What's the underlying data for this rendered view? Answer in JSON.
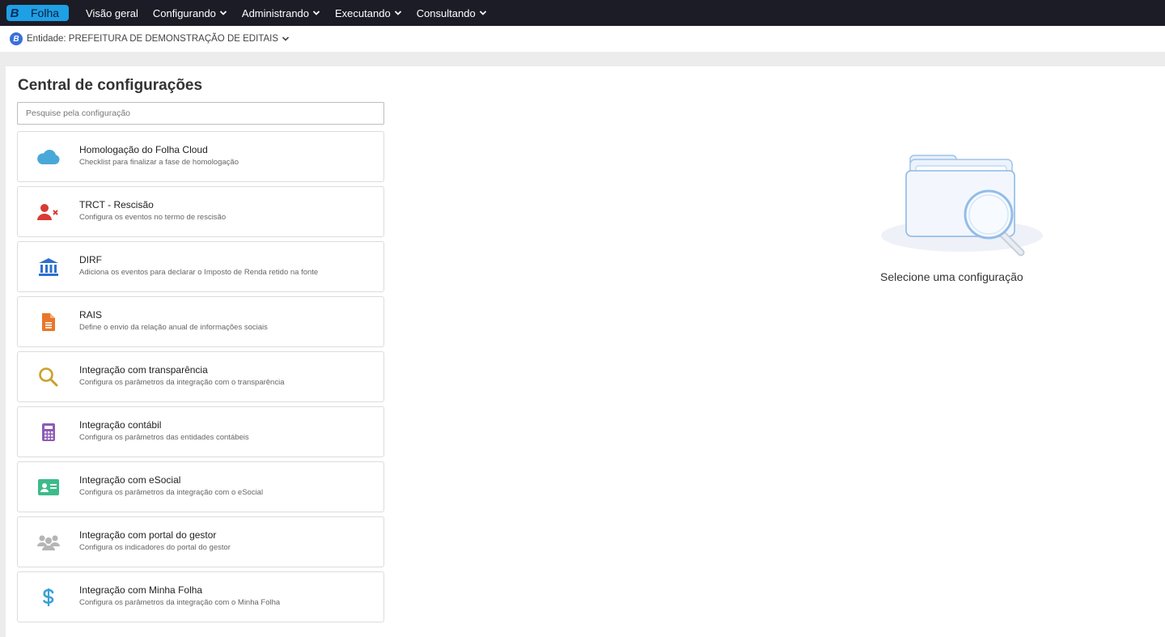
{
  "topbar": {
    "brand_letter": "B",
    "brand_name": "Folha",
    "nav": [
      {
        "label": "Visão geral",
        "dropdown": false
      },
      {
        "label": "Configurando",
        "dropdown": true
      },
      {
        "label": "Administrando",
        "dropdown": true
      },
      {
        "label": "Executando",
        "dropdown": true
      },
      {
        "label": "Consultando",
        "dropdown": true
      }
    ]
  },
  "entity": {
    "logo_letter": "B",
    "label": "Entidade: PREFEITURA DE DEMONSTRAÇÃO DE EDITAIS"
  },
  "main": {
    "title": "Central de configurações",
    "search_placeholder": "Pesquise pela configuração",
    "items": [
      {
        "title": "Homologação do Folha Cloud",
        "desc": "Checklist para finalizar a fase de homologação",
        "icon": "cloud-icon",
        "color": "#4aa8d8"
      },
      {
        "title": "TRCT - Rescisão",
        "desc": "Configura os eventos no termo de rescisão",
        "icon": "user-remove-icon",
        "color": "#d93a33"
      },
      {
        "title": "DIRF",
        "desc": "Adiciona os eventos para declarar o Imposto de Renda retido na fonte",
        "icon": "bank-icon",
        "color": "#2f6fce"
      },
      {
        "title": "RAIS",
        "desc": "Define o envio da relação anual de informações sociais",
        "icon": "document-icon",
        "color": "#e8772a"
      },
      {
        "title": "Integração com transparência",
        "desc": "Configura os parâmetros da integração com o transparência",
        "icon": "search-icon",
        "color": "#c9a227"
      },
      {
        "title": "Integração contábil",
        "desc": "Configura os parâmetros das entidades contábeis",
        "icon": "calculator-icon",
        "color": "#8e5bb5"
      },
      {
        "title": "Integração com eSocial",
        "desc": "Configura os parâmetros da integração com o eSocial",
        "icon": "id-card-icon",
        "color": "#3dbb8a"
      },
      {
        "title": "Integração com portal do gestor",
        "desc": "Configura os indicadores do portal do gestor",
        "icon": "users-icon",
        "color": "#b5b5b5"
      },
      {
        "title": "Integração com Minha Folha",
        "desc": "Configura os parâmetros da integração com o Minha Folha",
        "icon": "dollar-icon",
        "color": "#3aa0d6"
      }
    ],
    "empty_state": {
      "illustration": "folder-search-icon",
      "text": "Selecione uma configuração"
    }
  }
}
